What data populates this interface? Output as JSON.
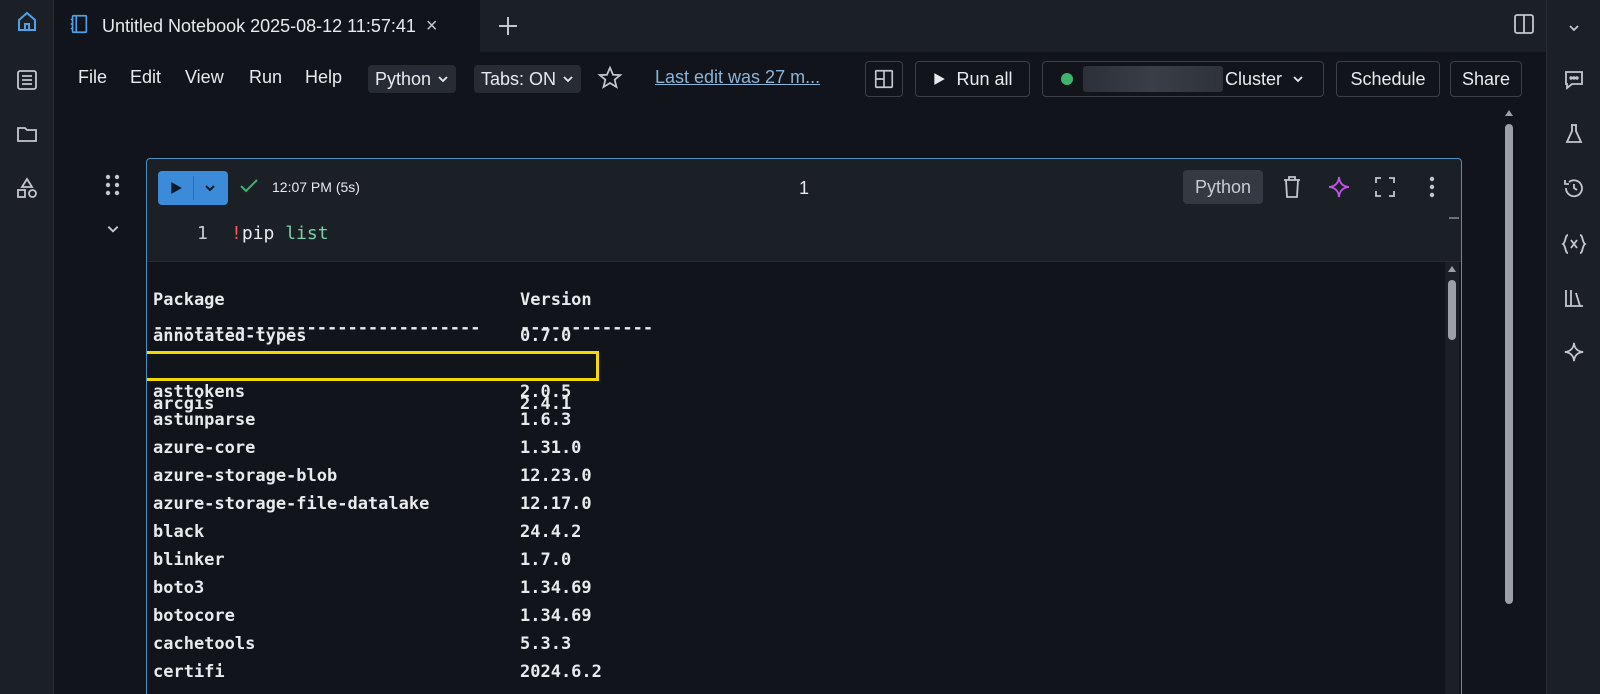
{
  "tab": {
    "title": "Untitled Notebook 2025-08-12 11:57:41",
    "close": "×",
    "add": "+"
  },
  "menu": {
    "file": "File",
    "edit": "Edit",
    "view": "View",
    "run": "Run",
    "help": "Help",
    "language": "Python",
    "tabs": "Tabs: ON",
    "last_edit": "Last edit was 27 m..."
  },
  "toolbar": {
    "run_all": "Run all",
    "cluster": "Cluster",
    "schedule": "Schedule",
    "share": "Share"
  },
  "cell": {
    "exec_time": "12:07 PM (5s)",
    "number": "1",
    "language": "Python",
    "line_number": "1",
    "code": {
      "bang": "!",
      "command": "pip",
      "arg": "list"
    }
  },
  "output": {
    "header": {
      "package": "Package",
      "version": "Version"
    },
    "divider": {
      "package": "--------------------------------",
      "version": "-------------"
    },
    "rows": [
      {
        "package": "annotated-types",
        "version": "0.7.0"
      },
      {
        "package": "arcgis",
        "version": "2.4.1"
      },
      {
        "package": "asttokens",
        "version": "2.0.5"
      },
      {
        "package": "astunparse",
        "version": "1.6.3"
      },
      {
        "package": "azure-core",
        "version": "1.31.0"
      },
      {
        "package": "azure-storage-blob",
        "version": "12.23.0"
      },
      {
        "package": "azure-storage-file-datalake",
        "version": "12.17.0"
      },
      {
        "package": "black",
        "version": "24.4.2"
      },
      {
        "package": "blinker",
        "version": "1.7.0"
      },
      {
        "package": "boto3",
        "version": "1.34.69"
      },
      {
        "package": "botocore",
        "version": "1.34.69"
      },
      {
        "package": "cachetools",
        "version": "5.3.3"
      },
      {
        "package": "certifi",
        "version": "2024.6.2"
      }
    ],
    "highlight_color": "#f5d800"
  },
  "colors": {
    "accent": "#3b8bd9",
    "status_ok": "#3cb46c",
    "link": "#8ab4d8"
  }
}
